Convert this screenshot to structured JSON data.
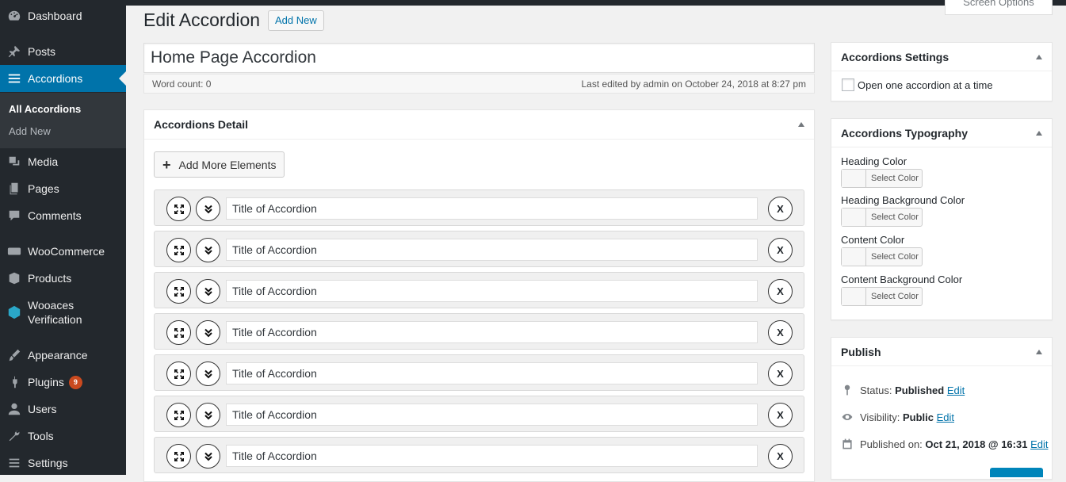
{
  "sidebar": {
    "items": [
      {
        "label": "Dashboard",
        "icon": "dashboard-icon"
      },
      {
        "label": "Posts",
        "icon": "pin-icon"
      },
      {
        "label": "Accordions",
        "icon": "list-icon"
      },
      {
        "label": "Media",
        "icon": "media-icon"
      },
      {
        "label": "Pages",
        "icon": "pages-icon"
      },
      {
        "label": "Comments",
        "icon": "comments-icon"
      },
      {
        "label": "WooCommerce",
        "icon": "woo-icon"
      },
      {
        "label": "Products",
        "icon": "box-icon"
      },
      {
        "label": "Wooaces",
        "label2": "Verification",
        "icon": "cube-icon"
      },
      {
        "label": "Appearance",
        "icon": "brush-icon"
      },
      {
        "label": "Plugins",
        "badge": "9",
        "icon": "plug-icon"
      },
      {
        "label": "Users",
        "icon": "user-icon"
      },
      {
        "label": "Tools",
        "icon": "wrench-icon"
      },
      {
        "label": "Settings",
        "icon": "settings-icon"
      }
    ],
    "submenu": [
      {
        "label": "All Accordions"
      },
      {
        "label": "Add New"
      }
    ]
  },
  "header": {
    "title": "Edit Accordion",
    "add_new": "Add New",
    "screen_options": "Screen Options"
  },
  "post": {
    "title": "Home Page Accordion",
    "word_count": "Word count: 0",
    "last_edited": "Last edited by admin on October 24, 2018 at 8:27 pm"
  },
  "detail_box": {
    "title": "Accordions Detail",
    "add_more": "Add More Elements",
    "rows": [
      {
        "value": "Title of Accordion"
      },
      {
        "value": "Title of Accordion"
      },
      {
        "value": "Title of Accordion"
      },
      {
        "value": "Title of Accordion"
      },
      {
        "value": "Title of Accordion"
      },
      {
        "value": "Title of Accordion"
      },
      {
        "value": "Title of Accordion"
      }
    ],
    "remove_label": "X"
  },
  "settings_box": {
    "title": "Accordions Settings",
    "checkbox_label": "Open one accordion at a time"
  },
  "typography_box": {
    "title": "Accordions Typography",
    "fields": [
      {
        "label": "Heading Color",
        "button": "Select Color"
      },
      {
        "label": "Heading Background Color",
        "button": "Select Color"
      },
      {
        "label": "Content Color",
        "button": "Select Color"
      },
      {
        "label": "Content Background Color",
        "button": "Select Color"
      }
    ]
  },
  "publish_box": {
    "title": "Publish",
    "status_label": "Status:",
    "status_value": "Published",
    "visibility_label": "Visibility:",
    "visibility_value": "Public",
    "published_label": "Published on:",
    "published_value": "Oct 21, 2018 @ 16:31",
    "edit": "Edit"
  },
  "colors": {
    "sidebar_bg": "#23282d",
    "accent": "#0073aa",
    "badge": "#ca4a1f"
  }
}
